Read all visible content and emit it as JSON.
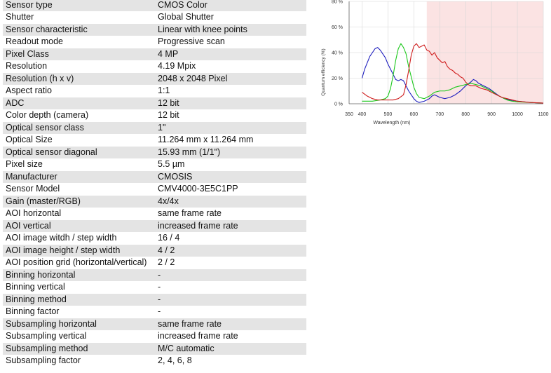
{
  "specs": [
    {
      "label": "Sensor type",
      "value": "CMOS Color"
    },
    {
      "label": "Shutter",
      "value": "Global Shutter"
    },
    {
      "label": "Sensor characteristic",
      "value": "Linear with knee points"
    },
    {
      "label": "Readout mode",
      "value": "Progressive scan"
    },
    {
      "label": "Pixel Class",
      "value": "4 MP"
    },
    {
      "label": "Resolution",
      "value": "4.19 Mpix"
    },
    {
      "label": "Resolution (h x v)",
      "value": "2048 x 2048 Pixel"
    },
    {
      "label": "Aspect ratio",
      "value": "1:1"
    },
    {
      "label": "ADC",
      "value": "12 bit"
    },
    {
      "label": "Color depth (camera)",
      "value": "12 bit"
    },
    {
      "label": "Optical sensor class",
      "value": "1\""
    },
    {
      "label": "Optical Size",
      "value": "11.264 mm x 11.264 mm"
    },
    {
      "label": "Optical sensor diagonal",
      "value": "15.93 mm (1/1\")"
    },
    {
      "label": "Pixel size",
      "value": "5.5 µm"
    },
    {
      "label": "Manufacturer",
      "value": "CMOSIS"
    },
    {
      "label": "Sensor Model",
      "value": "CMV4000-3E5C1PP"
    },
    {
      "label": "Gain (master/RGB)",
      "value": "4x/4x"
    },
    {
      "label": "AOI horizontal",
      "value": "same frame rate"
    },
    {
      "label": "AOI vertical",
      "value": "increased frame rate"
    },
    {
      "label": "AOI image witdh / step width",
      "value": "16 / 4"
    },
    {
      "label": "AOI image height / step width",
      "value": "4 / 2"
    },
    {
      "label": "AOI position grid (horizontal/vertical)",
      "value": "2 / 2"
    },
    {
      "label": "Binning horizontal",
      "value": "-"
    },
    {
      "label": "Binning vertical",
      "value": "-"
    },
    {
      "label": "Binning method",
      "value": "-"
    },
    {
      "label": "Binning factor",
      "value": "-"
    },
    {
      "label": "Subsampling horizontal",
      "value": "same frame rate"
    },
    {
      "label": "Subsampling vertical",
      "value": "increased frame rate"
    },
    {
      "label": "Subsampling method",
      "value": "M/C automatic"
    },
    {
      "label": "Subsampling factor",
      "value": "2, 4, 6, 8"
    }
  ],
  "chart_data": {
    "type": "line",
    "title": "",
    "xlabel": "Wavelength (nm)",
    "ylabel": "Quantum efficiency (%)",
    "xlim": [
      350,
      1100
    ],
    "ylim": [
      0,
      80
    ],
    "x_ticks": [
      350,
      400,
      500,
      600,
      700,
      800,
      900,
      1000,
      1100
    ],
    "y_ticks": [
      0,
      20,
      40,
      60,
      80
    ],
    "y_tick_labels": [
      "0 %",
      "20 %",
      "40 %",
      "60 %",
      "80 %"
    ],
    "grid": true,
    "highlight_band": {
      "from": 650,
      "to": 1100,
      "color": "#fbe3e3"
    },
    "series": [
      {
        "color": "#1e1ebe",
        "points": [
          [
            400,
            20
          ],
          [
            410,
            27
          ],
          [
            420,
            32
          ],
          [
            430,
            37
          ],
          [
            440,
            40
          ],
          [
            450,
            43
          ],
          [
            460,
            44
          ],
          [
            470,
            42
          ],
          [
            480,
            39
          ],
          [
            490,
            36
          ],
          [
            500,
            31
          ],
          [
            510,
            27
          ],
          [
            520,
            23
          ],
          [
            530,
            19
          ],
          [
            540,
            18
          ],
          [
            550,
            19
          ],
          [
            560,
            18
          ],
          [
            570,
            14
          ],
          [
            580,
            10
          ],
          [
            590,
            7
          ],
          [
            600,
            4
          ],
          [
            610,
            2
          ],
          [
            620,
            1
          ],
          [
            640,
            2
          ],
          [
            660,
            4
          ],
          [
            670,
            6
          ],
          [
            680,
            7
          ],
          [
            690,
            6
          ],
          [
            700,
            5
          ],
          [
            720,
            4
          ],
          [
            740,
            5
          ],
          [
            760,
            7
          ],
          [
            780,
            10
          ],
          [
            800,
            14
          ],
          [
            820,
            17
          ],
          [
            830,
            19
          ],
          [
            840,
            18
          ],
          [
            850,
            16
          ],
          [
            870,
            14
          ],
          [
            890,
            12
          ],
          [
            910,
            9
          ],
          [
            930,
            6
          ],
          [
            950,
            4
          ],
          [
            970,
            3
          ],
          [
            1000,
            2
          ],
          [
            1050,
            1
          ],
          [
            1100,
            0.5
          ]
        ]
      },
      {
        "color": "#1bc81b",
        "points": [
          [
            400,
            2
          ],
          [
            440,
            2
          ],
          [
            470,
            3
          ],
          [
            490,
            4
          ],
          [
            500,
            6
          ],
          [
            510,
            12
          ],
          [
            520,
            22
          ],
          [
            530,
            34
          ],
          [
            540,
            43
          ],
          [
            550,
            47
          ],
          [
            560,
            44
          ],
          [
            570,
            39
          ],
          [
            580,
            29
          ],
          [
            590,
            21
          ],
          [
            600,
            13
          ],
          [
            610,
            8
          ],
          [
            620,
            5
          ],
          [
            640,
            4
          ],
          [
            660,
            6
          ],
          [
            680,
            9
          ],
          [
            700,
            10
          ],
          [
            720,
            10
          ],
          [
            740,
            11
          ],
          [
            760,
            13
          ],
          [
            780,
            14
          ],
          [
            800,
            15
          ],
          [
            820,
            16
          ],
          [
            840,
            15
          ],
          [
            860,
            14
          ],
          [
            880,
            12
          ],
          [
            900,
            10
          ],
          [
            920,
            7
          ],
          [
            940,
            5
          ],
          [
            960,
            3
          ],
          [
            980,
            2
          ],
          [
            1000,
            1.5
          ],
          [
            1050,
            1
          ],
          [
            1100,
            0.5
          ]
        ]
      },
      {
        "color": "#cf1b1b",
        "points": [
          [
            400,
            9
          ],
          [
            420,
            6
          ],
          [
            440,
            4
          ],
          [
            460,
            3
          ],
          [
            480,
            3
          ],
          [
            500,
            3
          ],
          [
            520,
            3
          ],
          [
            540,
            4
          ],
          [
            560,
            7
          ],
          [
            570,
            15
          ],
          [
            580,
            26
          ],
          [
            590,
            38
          ],
          [
            600,
            45
          ],
          [
            610,
            47
          ],
          [
            620,
            44
          ],
          [
            630,
            45
          ],
          [
            640,
            46
          ],
          [
            650,
            42
          ],
          [
            660,
            41
          ],
          [
            670,
            38
          ],
          [
            680,
            40
          ],
          [
            690,
            36
          ],
          [
            700,
            34
          ],
          [
            710,
            32
          ],
          [
            720,
            33
          ],
          [
            730,
            29
          ],
          [
            740,
            27
          ],
          [
            750,
            26
          ],
          [
            760,
            24
          ],
          [
            770,
            23
          ],
          [
            780,
            21
          ],
          [
            790,
            20
          ],
          [
            800,
            17
          ],
          [
            810,
            15
          ],
          [
            820,
            14
          ],
          [
            840,
            14
          ],
          [
            860,
            12
          ],
          [
            880,
            11
          ],
          [
            900,
            9
          ],
          [
            920,
            7
          ],
          [
            940,
            5
          ],
          [
            960,
            4
          ],
          [
            980,
            3
          ],
          [
            1000,
            2
          ],
          [
            1050,
            1
          ],
          [
            1100,
            0.5
          ]
        ]
      }
    ]
  }
}
